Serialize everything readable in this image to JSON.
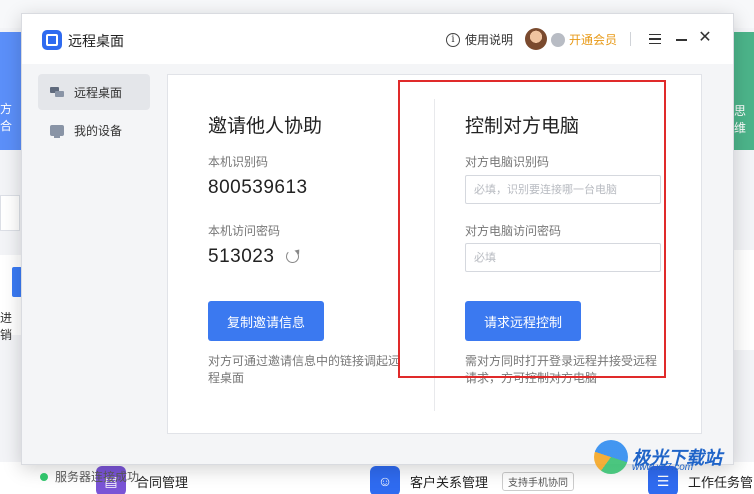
{
  "background": {
    "banner_left_text": "方合",
    "banner_right_text": "思维",
    "side_left_text": "进销",
    "bottom_items": [
      {
        "label": "合同管理",
        "icon": "contract-icon",
        "color": "#7a54d6"
      },
      {
        "label": "客户关系管理",
        "badge": "支持手机协同",
        "icon": "crm-icon",
        "color": "#2f6bf0"
      },
      {
        "label": "工作任务管",
        "icon": "task-icon",
        "color": "#2f6bf0"
      }
    ]
  },
  "dialog": {
    "title": "远程桌面",
    "help_label": "使用说明",
    "vip_label": "开通会员",
    "close_glyph": "✕"
  },
  "sidebar": {
    "items": [
      {
        "label": "远程桌面",
        "active": true
      },
      {
        "label": "我的设备",
        "active": false
      }
    ],
    "status": "服务器连接成功"
  },
  "invite": {
    "heading": "邀请他人协助",
    "id_label": "本机识别码",
    "id_value": "800539613",
    "pwd_label": "本机访问密码",
    "pwd_value": "513023",
    "button": "复制邀请信息",
    "note": "对方可通过邀请信息中的链接调起远程桌面"
  },
  "control": {
    "heading": "控制对方电脑",
    "id_label": "对方电脑识别码",
    "id_placeholder": "必填，识别要连接哪一台电脑",
    "pwd_label": "对方电脑访问密码",
    "pwd_placeholder": "必填",
    "button": "请求远程控制",
    "note": "需对方同时打开登录远程并接受远程请求，方可控制对方电脑"
  },
  "watermark": {
    "text": "极光下载站",
    "sub": "www.xz7.com"
  },
  "colors": {
    "accent": "#3b79f0",
    "highlight": "#e02a2a",
    "vip": "#e89a18",
    "status_ok": "#31c36b"
  }
}
